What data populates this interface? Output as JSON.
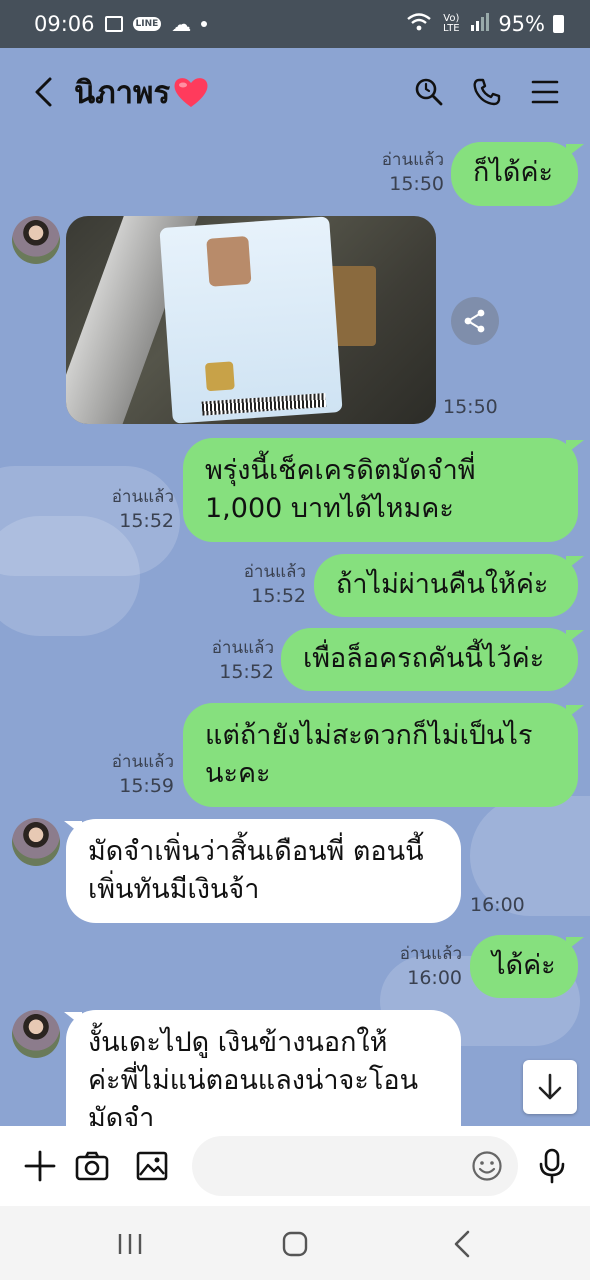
{
  "status_bar": {
    "time": "09:06",
    "network_label": "Vo) LTE",
    "battery": "95%"
  },
  "header": {
    "contact_name": "นิภาพร",
    "icons": [
      "back-icon",
      "heart-icon",
      "search-icon",
      "phone-icon",
      "menu-icon"
    ]
  },
  "messages": [
    {
      "id": "m1",
      "direction": "out",
      "text": "ก็ได้ค่ะ",
      "read": "อ่านแล้ว",
      "time": "15:50"
    },
    {
      "id": "m2",
      "direction": "in",
      "type": "image",
      "alt": "Thai National ID Card",
      "time": "15:50"
    },
    {
      "id": "m3",
      "direction": "out",
      "lines": [
        "พรุ่งนี้เช็คเครดิตมัดจำพี่",
        "1,000 บาทได้ไหมคะ"
      ],
      "read": "อ่านแล้ว",
      "time": "15:52"
    },
    {
      "id": "m4",
      "direction": "out",
      "text": "ถ้าไม่ผ่านคืนให้ค่ะ",
      "read": "อ่านแล้ว",
      "time": "15:52"
    },
    {
      "id": "m5",
      "direction": "out",
      "text": "เพื่อล็อครถคันนี้ไว้ค่ะ",
      "read": "อ่านแล้ว",
      "time": "15:52"
    },
    {
      "id": "m6",
      "direction": "out",
      "lines": [
        "แต่ถ้ายังไม่สะดวกก็ไม่เป็นไร",
        "นะคะ"
      ],
      "read": "อ่านแล้ว",
      "time": "15:59"
    },
    {
      "id": "m7",
      "direction": "in",
      "lines": [
        "มัดจำเพิ่นว่าสิ้นเดือนพี่ ตอนนี้",
        "เพิ่นทันมีเงินจ้า"
      ],
      "time": "16:00"
    },
    {
      "id": "m8",
      "direction": "out",
      "text": "ได้ค่ะ",
      "read": "อ่านแล้ว",
      "time": "16:00"
    },
    {
      "id": "m9",
      "direction": "in",
      "lines": [
        "งั้นเดะไปดู เงินข้างนอกให้",
        "ค่ะพี่ไม่แน่ตอนแลงน่าจะโอน",
        "มัดจำ"
      ]
    }
  ],
  "input": {
    "placeholder": ""
  },
  "colors": {
    "chat_bg": "#8ca4d2",
    "outgoing_bubble": "#86e07e",
    "incoming_bubble": "#ffffff",
    "status_bar": "#46505a"
  }
}
